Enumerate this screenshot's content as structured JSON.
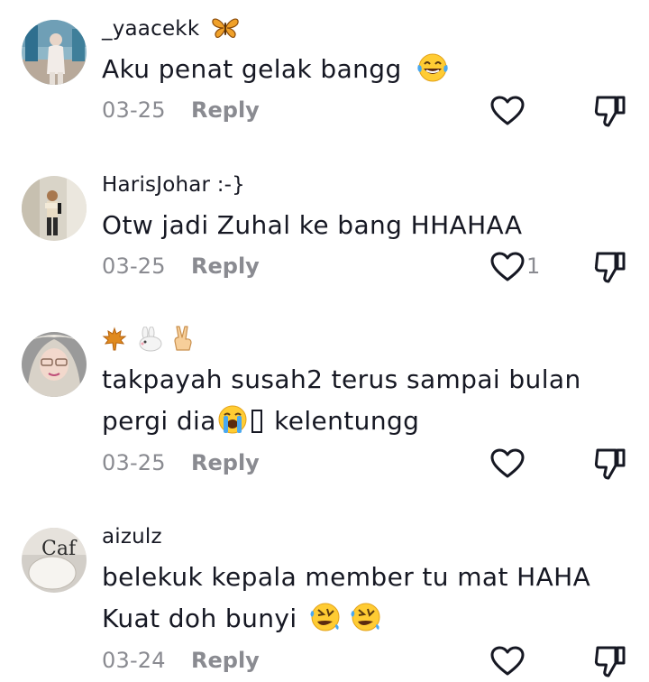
{
  "comments": [
    {
      "username": "_yaacekk",
      "username_icons": [
        "butterfly-icon"
      ],
      "lines": [
        "Aku penat gelak bangg"
      ],
      "trailing_emoji": "laughing-tears-emoji",
      "date": "03-25",
      "reply_label": "Reply",
      "like_count": ""
    },
    {
      "username": "HarisJohar :-}",
      "lines": [
        "Otw jadi Zuhal ke bang HHAHAA"
      ],
      "date": "03-25",
      "reply_label": "Reply",
      "like_count": "1"
    },
    {
      "username": "",
      "username_icons": [
        "maple-leaf-icon",
        "rabbit-icon",
        "victory-hand-icon"
      ],
      "lines": [
        "takpayah susah2 terus sampai bulan",
        "pergi dia",
        "kelentungg"
      ],
      "date": "03-25",
      "reply_label": "Reply",
      "like_count": ""
    },
    {
      "username": "aizulz",
      "lines": [
        "belekuk kepala member tu mat HAHA",
        "Kuat doh bunyi"
      ],
      "date": "03-24",
      "reply_label": "Reply",
      "like_count": "",
      "avatar_text": "Caf"
    }
  ],
  "colors": {
    "primary_text": "#161823",
    "secondary_text": "#8a8b91"
  }
}
